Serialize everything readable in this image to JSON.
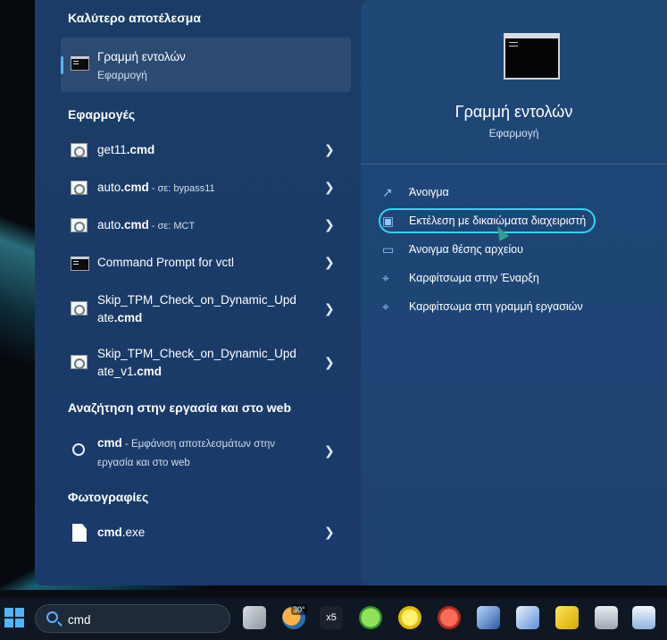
{
  "left": {
    "best_match_title": "Καλύτερο αποτέλεσμα",
    "best_match": {
      "name": "Γραμμή εντολών",
      "type": "Εφαρμογή"
    },
    "apps_title": "Εφαρμογές",
    "apps": [
      {
        "bold": "",
        "rest": "get11",
        "bold2": ".cmd",
        "meta": ""
      },
      {
        "bold": "",
        "rest": "auto",
        "bold2": ".cmd",
        "meta": " - σε: bypass11"
      },
      {
        "bold": "",
        "rest": "auto",
        "bold2": ".cmd",
        "meta": " - σε: MCT"
      },
      {
        "bold": "",
        "rest": "Command Prompt for vctl",
        "bold2": "",
        "meta": ""
      },
      {
        "line1": "Skip_TPM_Check_on_Dynamic_Upd",
        "line2a": "ate",
        "line2b": ".cmd"
      },
      {
        "line1": "Skip_TPM_Check_on_Dynamic_Upd",
        "line2a": "ate_v1",
        "line2b": ".cmd"
      }
    ],
    "web_title": "Αναζήτηση στην εργασία και στο web",
    "web_item": {
      "bold": "cmd",
      "line1_rest": " - Εμφάνιση αποτελεσμάτων στην",
      "line2": "εργασία και στο web"
    },
    "photos_title": "Φωτογραφίες",
    "photo_item": {
      "bold": "cmd",
      "rest": ".exe"
    }
  },
  "right": {
    "title": "Γραμμή εντολών",
    "subtitle": "Εφαρμογή",
    "actions": [
      {
        "label": "Άνοιγμα",
        "icon": "open-external-icon"
      },
      {
        "label": "Εκτέλεση με δικαιώματα διαχειριστή",
        "icon": "shield-icon"
      },
      {
        "label": "Άνοιγμα θέσης αρχείου",
        "icon": "folder-icon"
      },
      {
        "label": "Καρφίτσωμα στην Έναρξη",
        "icon": "pin-icon"
      },
      {
        "label": "Καρφίτσωμα στη γραμμή εργασιών",
        "icon": "pin-icon"
      }
    ]
  },
  "taskbar": {
    "search_value": "cmd",
    "weather_badge": "30°"
  },
  "colors": {
    "panel_bg": "#1a3c66",
    "highlight_ring": "#2fd5f0",
    "accent": "#5fb2f2"
  }
}
